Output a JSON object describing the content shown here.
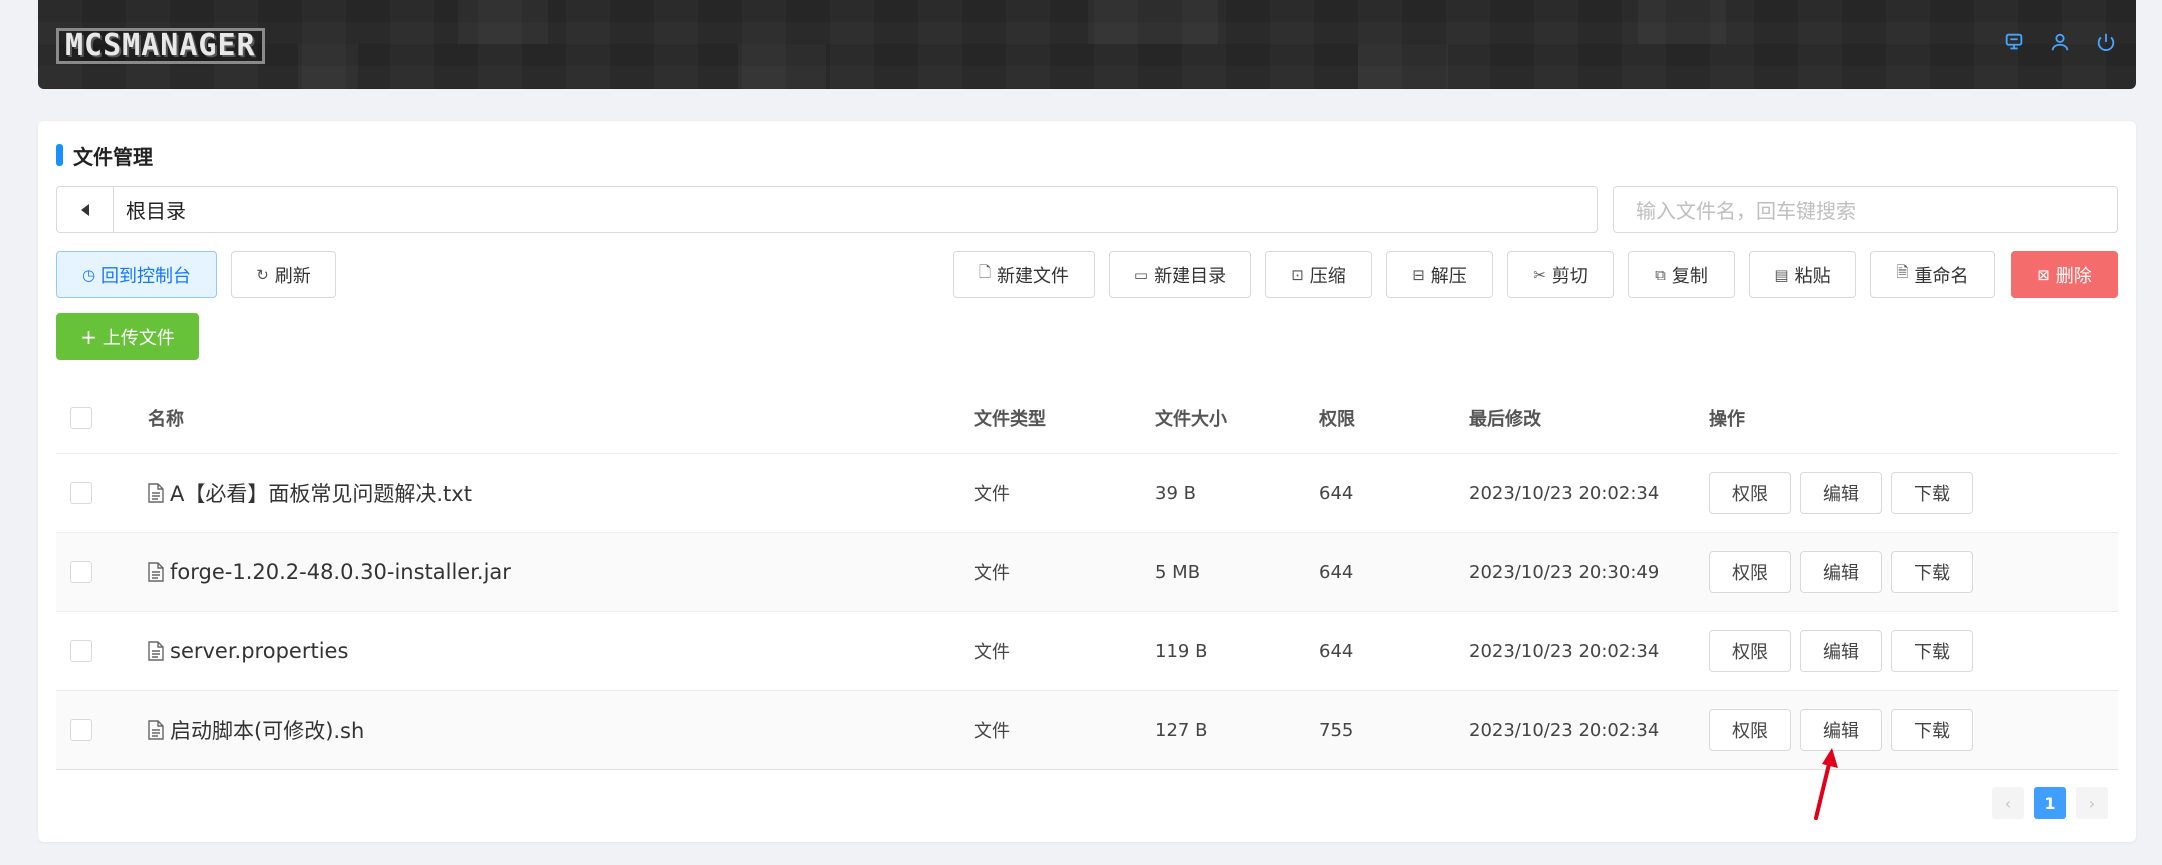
{
  "header": {
    "logo_text": "MCSMANAGER",
    "icons": [
      "notification-icon",
      "user-icon",
      "power-icon"
    ]
  },
  "card": {
    "title": "文件管理"
  },
  "path": {
    "current": "根目录"
  },
  "search": {
    "placeholder": "输入文件名，回车键搜索"
  },
  "toolbar": {
    "back_to_console": "回到控制台",
    "refresh": "刷新",
    "new_file": "新建文件",
    "new_dir": "新建目录",
    "compress": "压缩",
    "extract": "解压",
    "cut": "剪切",
    "copy": "复制",
    "paste": "粘贴",
    "rename": "重命名",
    "delete": "删除",
    "upload": "上传文件"
  },
  "table": {
    "columns": [
      "名称",
      "文件类型",
      "文件大小",
      "权限",
      "最后修改",
      "操作"
    ],
    "rows": [
      {
        "name": "A【必看】面板常见问题解决.txt",
        "type": "文件",
        "size": "39 B",
        "perm": "644",
        "modified": "2023/10/23 20:02:34"
      },
      {
        "name": "forge-1.20.2-48.0.30-installer.jar",
        "type": "文件",
        "size": "5 MB",
        "perm": "644",
        "modified": "2023/10/23 20:30:49"
      },
      {
        "name": "server.properties",
        "type": "文件",
        "size": "119 B",
        "perm": "644",
        "modified": "2023/10/23 20:02:34"
      },
      {
        "name": "启动脚本(可修改).sh",
        "type": "文件",
        "size": "127 B",
        "perm": "755",
        "modified": "2023/10/23 20:02:34"
      }
    ],
    "ops": {
      "perm": "权限",
      "edit": "编辑",
      "download": "下载"
    }
  },
  "pagination": {
    "current": "1",
    "prev": "‹",
    "next": "›"
  },
  "colors": {
    "accent": "#1890ff",
    "danger": "#f56c6c",
    "success": "#67c23a",
    "annotation": "#e0001a"
  }
}
